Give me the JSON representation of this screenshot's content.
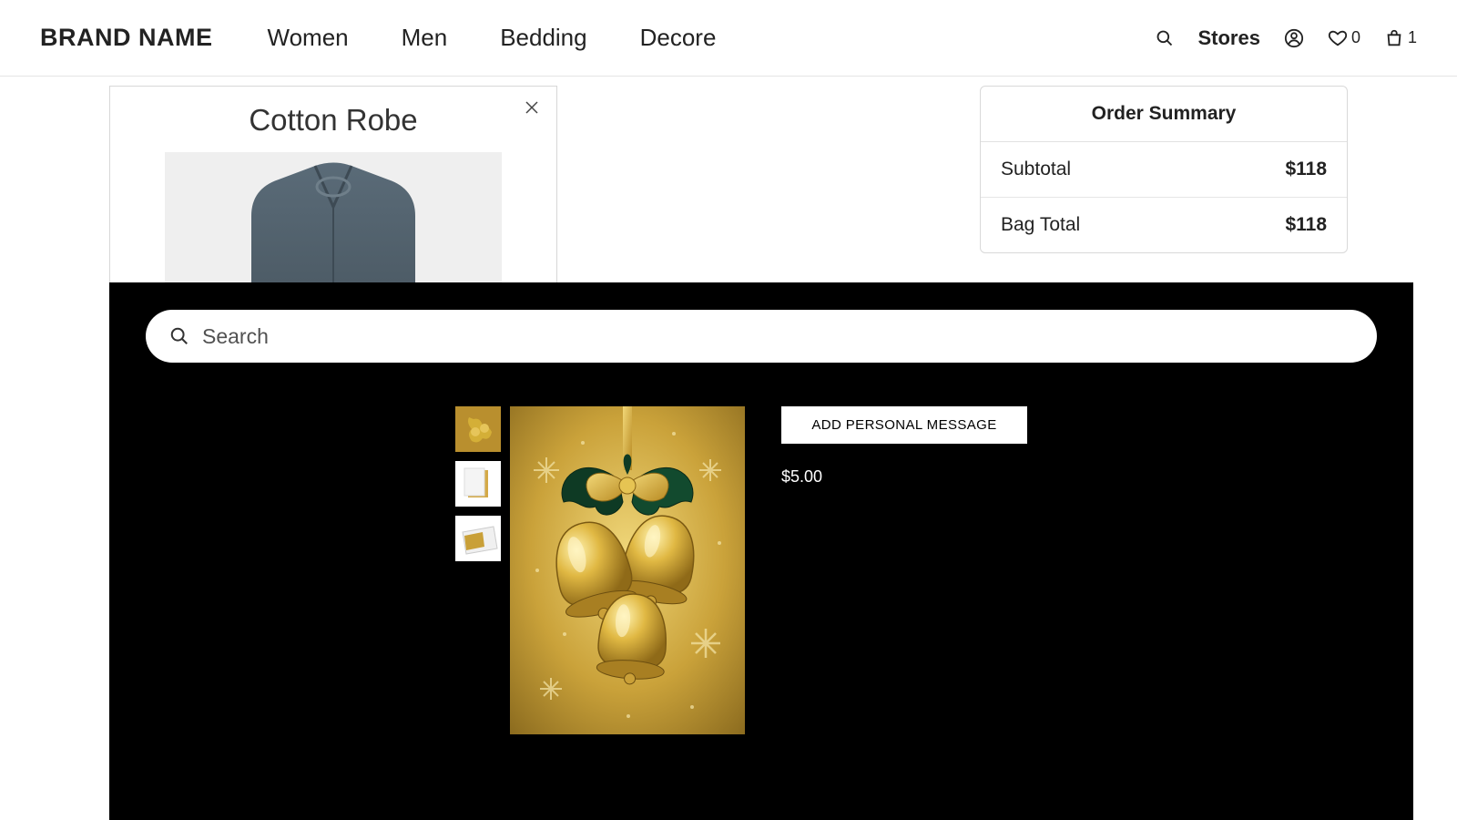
{
  "header": {
    "brand": "BRAND NAME",
    "nav": [
      "Women",
      "Men",
      "Bedding",
      "Decore"
    ],
    "stores": "Stores",
    "wishlist_count": "0",
    "bag_count": "1"
  },
  "cart_item": {
    "title": "Cotton Robe"
  },
  "order_summary": {
    "title": "Order Summary",
    "rows": [
      {
        "label": "Subtotal",
        "value": "$118"
      },
      {
        "label": "Bag Total",
        "value": "$118"
      }
    ]
  },
  "overlay": {
    "search_placeholder": "Search",
    "add_message_button": "ADD PERSONAL MESSAGE",
    "price": "$5.00"
  }
}
